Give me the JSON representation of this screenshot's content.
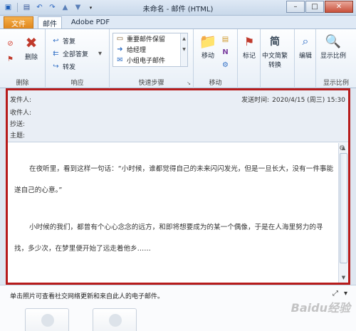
{
  "window": {
    "title": "未命名 - 邮件 (HTML)",
    "controls": {
      "minimize": "–",
      "maximize": "□",
      "close": "✕"
    }
  },
  "tabs": {
    "file": "文件",
    "mail": "邮件",
    "pdf": "Adobe PDF"
  },
  "ribbon": {
    "delete_group": {
      "label": "删除",
      "delete": "删除"
    },
    "respond_group": {
      "label": "响应",
      "reply": "答复",
      "reply_all": "全部答复",
      "forward": "转发"
    },
    "quicksteps_group": {
      "label": "快速步骤",
      "items": [
        "重要邮件保留",
        "给经理",
        "小组电子邮件"
      ]
    },
    "move_group": {
      "label": "移动",
      "move": "移动"
    },
    "tags_group": {
      "tag": "标记"
    },
    "chinese_group": {
      "convert": "中文简繁",
      "convert2": "转换"
    },
    "edit_group": {
      "edit": "编辑"
    },
    "zoom_group": {
      "label": "显示比例",
      "zoom": "显示比例"
    }
  },
  "message": {
    "from_label": "发件人:",
    "to_label": "收件人:",
    "cc_label": "抄送:",
    "subject_label": "主题:",
    "sent_label": "发送时间:",
    "sent_value": "2020/4/15 (周三) 15:30",
    "paragraph1": "在夜听里，看到这样一句话：“小时候，谁都觉得自己的未来闪闪发光，但是一旦长大，没有一件事能遂自己的心意。”",
    "paragraph2": "小时候的我们，都曾有个心心念念的远方，和即将想要成为的某一个偶像，于是在人海里努力的寻找，多少次，在梦里便开始了远走着他乡……"
  },
  "people_pane": {
    "text": "单击照片可查看社交网络更新和来自此人的电子邮件。",
    "watermark": "Baidu经验"
  },
  "colors": {
    "file_tab": "#e0861c",
    "highlight_border": "#b71b1b"
  }
}
